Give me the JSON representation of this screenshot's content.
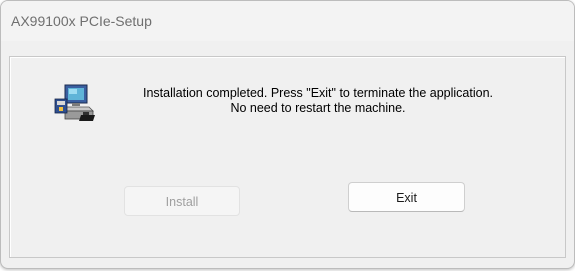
{
  "window": {
    "title": "AX99100x PCIe-Setup"
  },
  "dialog": {
    "icon": "computer-setup-icon",
    "message_line1": "Installation completed. Press \"Exit\" to terminate the application.",
    "message_line2": "No need to restart the machine."
  },
  "buttons": {
    "install_label": "Install",
    "install_enabled": false,
    "exit_label": "Exit"
  }
}
